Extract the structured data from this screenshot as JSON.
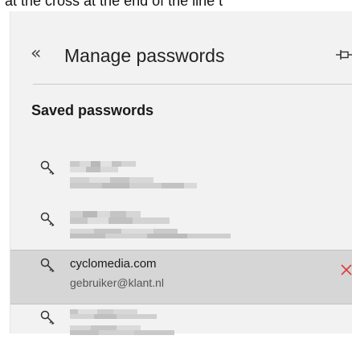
{
  "caption": "at the cross at the end of the line t",
  "header": {
    "back_icon": "double-chevron-left-icon",
    "title": "Manage passwords",
    "pin_icon": "pin-icon"
  },
  "section_title": "Saved passwords",
  "entries": [
    {
      "site": "",
      "username": "",
      "obscured": true
    },
    {
      "site": "",
      "username": "",
      "obscured": true
    },
    {
      "site": "cyclomedia.com",
      "username": "gebruiker@klant.nl",
      "obscured": false,
      "selected": true,
      "remove_icon": "close-icon"
    },
    {
      "site": "",
      "username": "",
      "obscured": true
    }
  ],
  "colors": {
    "panel_bg": "#f2f2f2",
    "selected_row_bg": "#d6d6d6",
    "remove_icon": "#e03a3a"
  }
}
